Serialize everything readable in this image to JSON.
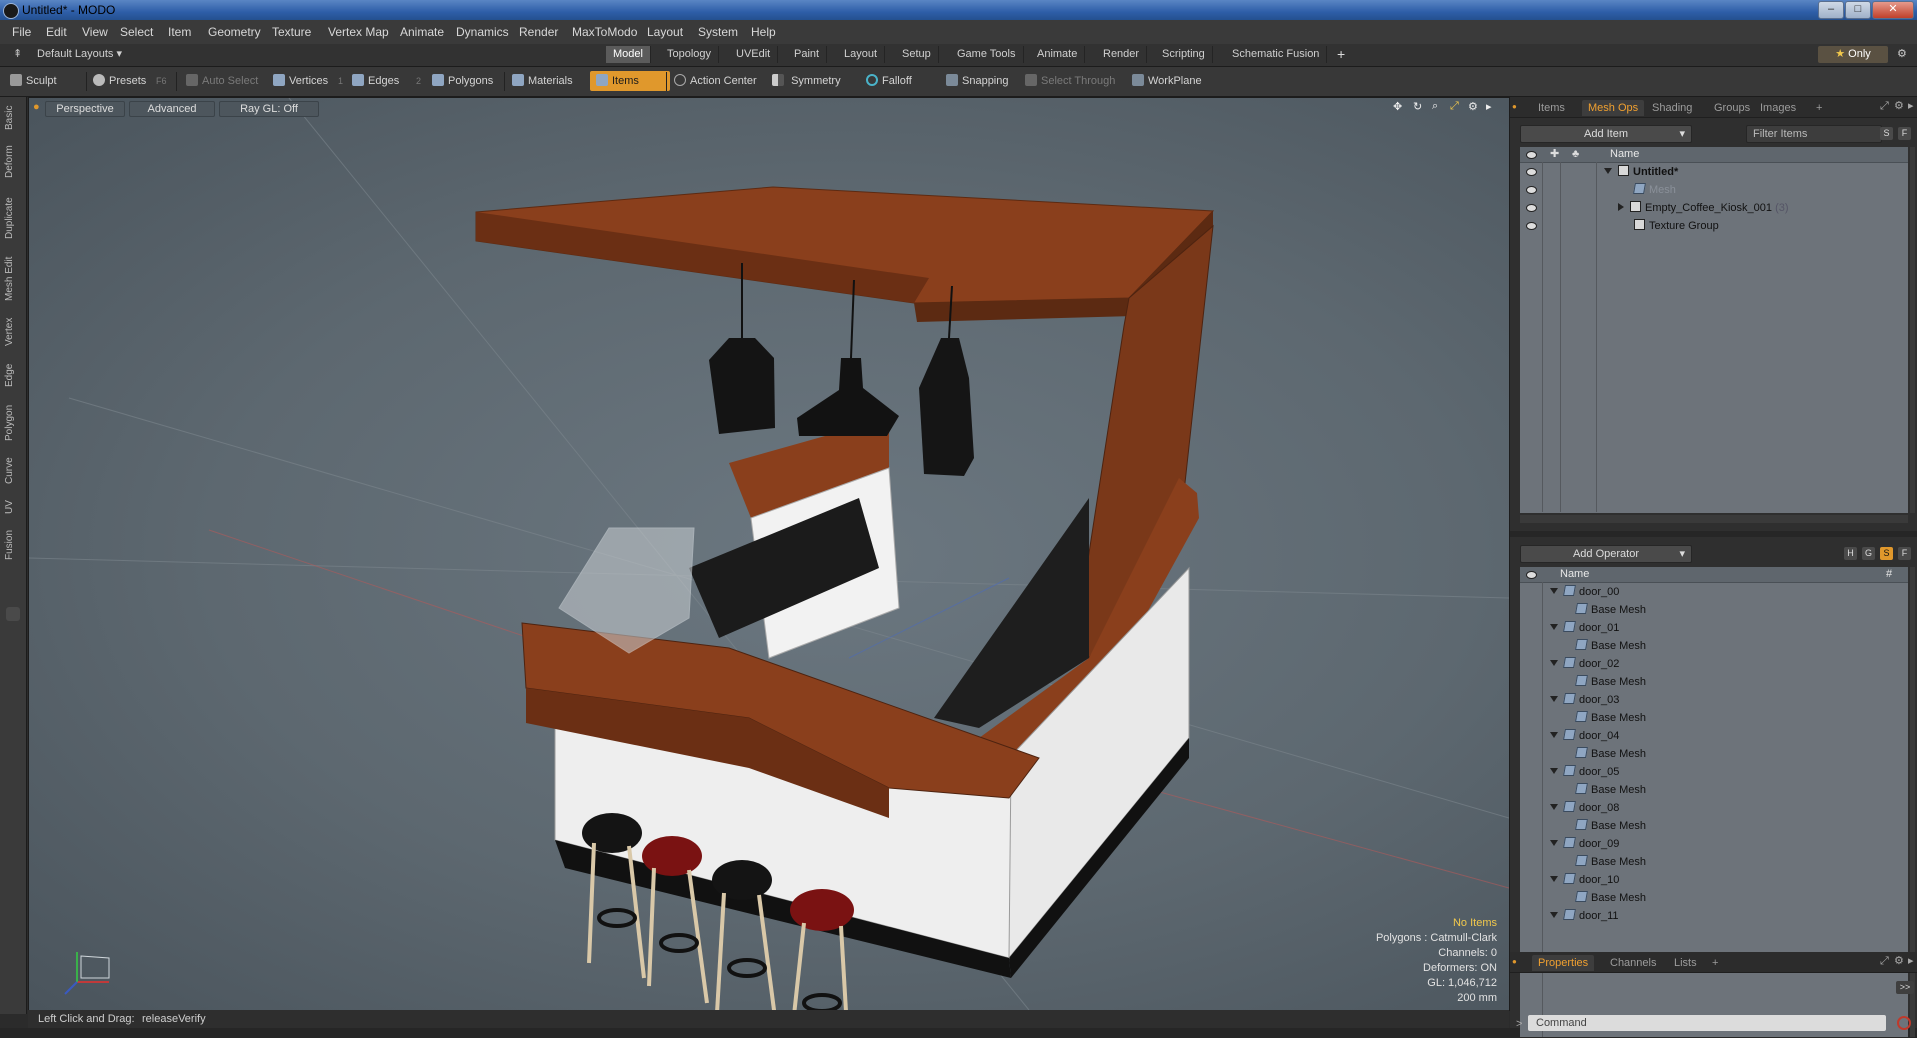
{
  "window": {
    "title": "Untitled* - MODO",
    "controls": [
      "minimize",
      "maximize",
      "close"
    ]
  },
  "menubar": [
    "File",
    "Edit",
    "View",
    "Select",
    "Item",
    "Geometry",
    "Texture",
    "Vertex Map",
    "Animate",
    "Dynamics",
    "Render",
    "MaxToModo",
    "Layout",
    "System",
    "Help"
  ],
  "layoutbar": {
    "layout_selector": "Default Layouts",
    "tabs": [
      "Model",
      "Topology",
      "UVEdit",
      "Paint",
      "Layout",
      "Setup",
      "Game Tools",
      "Animate",
      "Render",
      "Scripting",
      "Schematic Fusion"
    ],
    "active_tab": "Model",
    "add_label": "+",
    "only_label": "Only"
  },
  "toolbar": {
    "sculpt": "Sculpt",
    "presets": "Presets",
    "presets_hint": "F6",
    "auto_select": "Auto Select",
    "vertices": "Vertices",
    "vertices_hint": "1",
    "edges": "Edges",
    "edges_hint": "2",
    "polygons": "Polygons",
    "materials": "Materials",
    "items": "Items",
    "action_center": "Action Center",
    "symmetry": "Symmetry",
    "falloff": "Falloff",
    "snapping": "Snapping",
    "select_through": "Select Through",
    "workplane": "WorkPlane"
  },
  "left_tabs": [
    "Basic",
    "Deform",
    "Duplicate",
    "Mesh Edit",
    "Vertex",
    "Edge",
    "Polygon",
    "Curve",
    "UV",
    "Fusion"
  ],
  "viewport": {
    "view": "Perspective",
    "shading": "Advanced",
    "raygl": "Ray GL: Off",
    "stats": {
      "selection": "No Items",
      "polygons": "Polygons : Catmull-Clark",
      "channels": "Channels: 0",
      "deformers": "Deformers: ON",
      "gl": "GL: 1,046,712",
      "grid": "200 mm"
    }
  },
  "statusbar": {
    "label": "Left Click and Drag:",
    "value": "releaseVerify"
  },
  "items_panel": {
    "tabs": [
      "Items",
      "Mesh Ops",
      "Shading",
      "Groups",
      "Images",
      "+"
    ],
    "active_tab": "Mesh Ops",
    "add_item": "Add Item",
    "filter_placeholder": "Filter Items",
    "btn_s": "S",
    "btn_f": "F",
    "column_name": "Name",
    "tree": [
      {
        "label": "Untitled*",
        "count": ""
      },
      {
        "label": "Mesh",
        "count": ""
      },
      {
        "label": "Empty_Coffee_Kiosk_001",
        "count": "(3)"
      },
      {
        "label": "Texture Group",
        "count": ""
      }
    ]
  },
  "meshops_panel": {
    "add_operator": "Add Operator",
    "btns": [
      "H",
      "G",
      "S",
      "F"
    ],
    "column_name": "Name",
    "column_hash": "#",
    "items": [
      {
        "name": "door_00",
        "child": "Base Mesh"
      },
      {
        "name": "door_01",
        "child": "Base Mesh"
      },
      {
        "name": "door_02",
        "child": "Base Mesh"
      },
      {
        "name": "door_03",
        "child": "Base Mesh"
      },
      {
        "name": "door_04",
        "child": "Base Mesh"
      },
      {
        "name": "door_05",
        "child": "Base Mesh"
      },
      {
        "name": "door_08",
        "child": "Base Mesh"
      },
      {
        "name": "door_09",
        "child": "Base Mesh"
      },
      {
        "name": "door_10",
        "child": "Base Mesh"
      },
      {
        "name": "door_11",
        "child": ""
      }
    ]
  },
  "properties_panel": {
    "tabs": [
      "Properties",
      "Channels",
      "Lists",
      "+"
    ],
    "active_tab": "Properties",
    "expand": ">>",
    "command_placeholder": "Command"
  },
  "colors": {
    "accent": "#e0982c",
    "viewport": "#5f6a72",
    "wood": "#8a3f1c"
  }
}
